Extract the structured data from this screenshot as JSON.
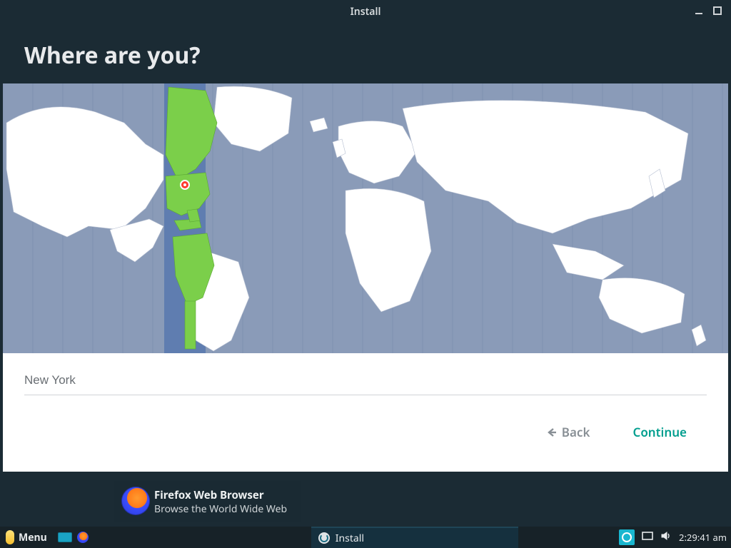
{
  "window": {
    "title": "Install",
    "heading": "Where are you?"
  },
  "location": {
    "value": "New York"
  },
  "nav": {
    "back": "Back",
    "continue": "Continue"
  },
  "tooltip": {
    "title": "Firefox Web Browser",
    "subtitle": "Browse the World Wide Web"
  },
  "taskbar": {
    "menu": "Menu",
    "active_task": "Install",
    "clock": "2:29:41 am"
  },
  "icons": {
    "minimize": "minimize-icon",
    "maximize": "maximize-icon",
    "arrow_left": "arrow-left-icon",
    "pin": "pin-icon",
    "show_desktop": "show-desktop-icon",
    "volume": "volume-icon"
  },
  "colors": {
    "accent": "#009e8e",
    "highlight_land": "#7bcf4a",
    "ocean": "#8a9bb8"
  }
}
